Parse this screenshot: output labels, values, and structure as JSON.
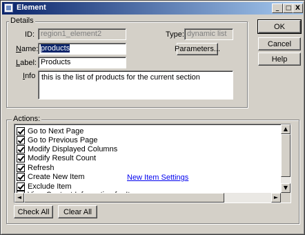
{
  "window": {
    "title": "Element",
    "controls": {
      "minimize": "_",
      "maximize": "□",
      "close": "X"
    }
  },
  "details": {
    "group_label": "Details",
    "id_label": "ID:",
    "id_value": "region1_element2",
    "type_label": "Type:",
    "type_value": "dynamic list",
    "name_label": "Name:",
    "name_value": "products",
    "label_label": "Label:",
    "label_value": "Products",
    "info_label": "Info",
    "info_value": "this is the list of products for the current section",
    "parameters_button": "Parameters..."
  },
  "buttons": {
    "ok": "OK",
    "cancel": "Cancel",
    "help": "Help"
  },
  "actions": {
    "group_label": "Actions:",
    "items": [
      {
        "label": "Go to Next Page",
        "checked": true
      },
      {
        "label": "Go to Previous Page",
        "checked": true
      },
      {
        "label": "Modify Displayed Columns",
        "checked": true
      },
      {
        "label": "Modify Result Count",
        "checked": true
      },
      {
        "label": "Refresh",
        "checked": true
      },
      {
        "label": "Create New Item",
        "checked": true
      },
      {
        "label": "Exclude Item",
        "checked": true
      },
      {
        "label": "View Content Information for Item",
        "checked": true
      }
    ],
    "new_item_settings_link": "New Item Settings",
    "check_all_button": "Check All",
    "clear_all_button": "Clear All"
  },
  "scrollbar": {
    "up_icon": "▲",
    "down_icon": "▼",
    "left_icon": "◄",
    "right_icon": "►"
  }
}
